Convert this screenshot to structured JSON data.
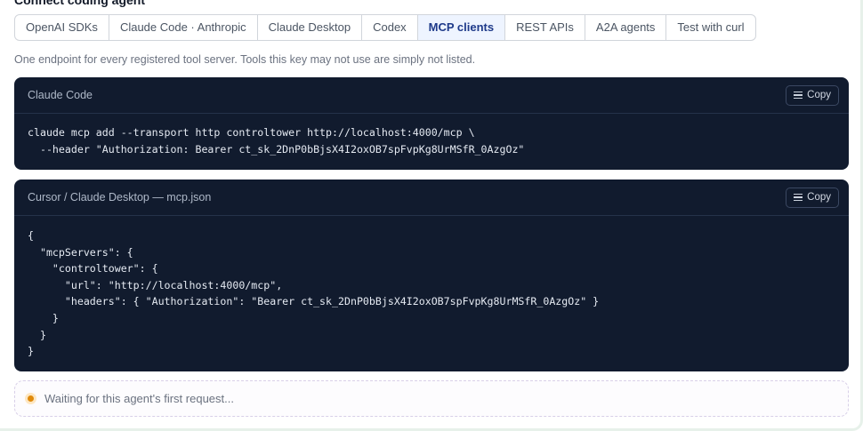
{
  "section": {
    "title": "Connect coding agent"
  },
  "tabs": [
    {
      "label": "OpenAI SDKs",
      "active": false
    },
    {
      "label": "Claude Code · Anthropic",
      "active": false
    },
    {
      "label": "Claude Desktop",
      "active": false
    },
    {
      "label": "Codex",
      "active": false
    },
    {
      "label": "MCP clients",
      "active": true
    },
    {
      "label": "REST APIs",
      "active": false
    },
    {
      "label": "A2A agents",
      "active": false
    },
    {
      "label": "Test with curl",
      "active": false
    }
  ],
  "description": "One endpoint for every registered tool server. Tools this key may not use are simply not listed.",
  "code_blocks": [
    {
      "title": "Claude Code",
      "copy_label": "Copy",
      "code": "claude mcp add --transport http controltower http://localhost:4000/mcp \\\n  --header \"Authorization: Bearer ct_sk_2DnP0bBjsX4I2oxOB7spFvpKg8UrMSfR_0AzgOz\""
    },
    {
      "title": "Cursor / Claude Desktop — mcp.json",
      "copy_label": "Copy",
      "code": "{\n  \"mcpServers\": {\n    \"controltower\": {\n      \"url\": \"http://localhost:4000/mcp\",\n      \"headers\": { \"Authorization\": \"Bearer ct_sk_2DnP0bBjsX4I2oxOB7spFvpKg8UrMSfR_0AzgOz\" }\n    }\n  }\n}"
    }
  ],
  "status": {
    "text": "Waiting for this agent's first request...",
    "indicator_color": "#e08a0b"
  },
  "colors": {
    "code_background": "#111b2e",
    "active_tab_background": "#eef4ff",
    "active_tab_text": "#1e3a8a"
  }
}
